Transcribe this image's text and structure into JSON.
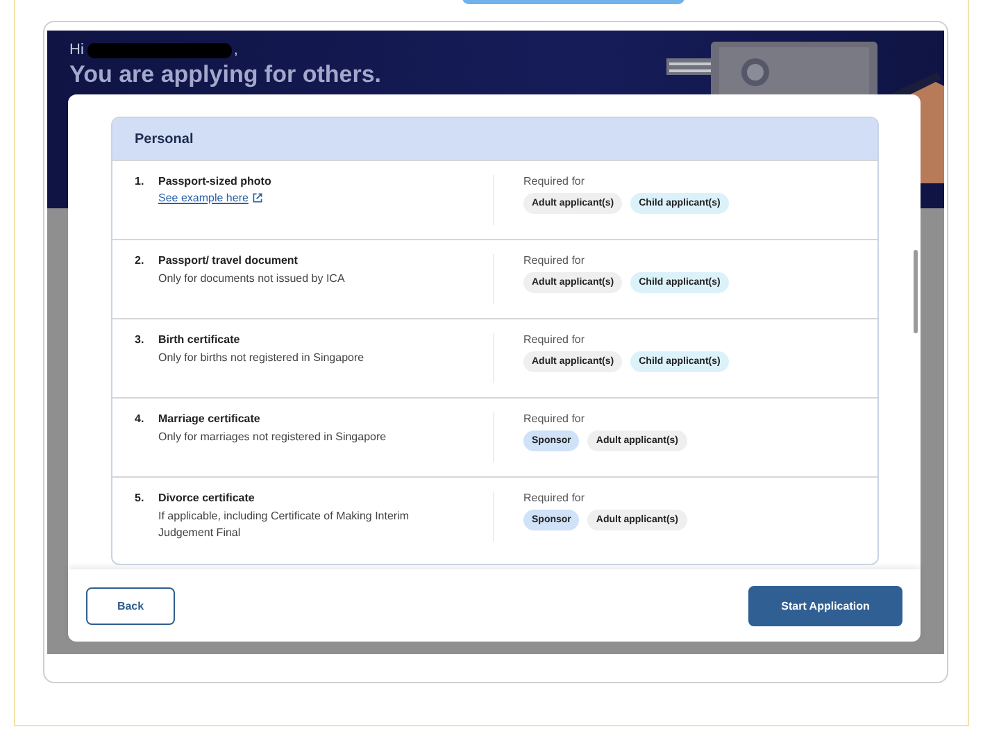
{
  "hero": {
    "greeting": "Hi",
    "greeting_end": ",",
    "title": "You are applying for others."
  },
  "section": {
    "title": "Personal"
  },
  "documents": [
    {
      "number": "1.",
      "title": "Passport-sized photo",
      "link": "See example here",
      "required_label": "Required for",
      "tags": [
        {
          "label": "Adult applicant(s)",
          "color": "#efefef"
        },
        {
          "label": "Child applicant(s)",
          "color": "#dcf2fb"
        }
      ]
    },
    {
      "number": "2.",
      "title": "Passport/ travel document",
      "note": "Only for documents not issued by ICA",
      "required_label": "Required for",
      "tags": [
        {
          "label": "Adult applicant(s)",
          "color": "#efefef"
        },
        {
          "label": "Child applicant(s)",
          "color": "#dcf2fb"
        }
      ]
    },
    {
      "number": "3.",
      "title": "Birth certificate",
      "note": "Only for births not registered in Singapore",
      "required_label": "Required for",
      "tags": [
        {
          "label": "Adult applicant(s)",
          "color": "#efefef"
        },
        {
          "label": "Child applicant(s)",
          "color": "#dcf2fb"
        }
      ]
    },
    {
      "number": "4.",
      "title": "Marriage certificate",
      "note": "Only for marriages not registered in Singapore",
      "required_label": "Required for",
      "tags": [
        {
          "label": "Sponsor",
          "color": "#cfe2f8"
        },
        {
          "label": "Adult applicant(s)",
          "color": "#efefef"
        }
      ]
    },
    {
      "number": "5.",
      "title": "Divorce certificate",
      "note": "If applicable, including Certificate of Making Interim Judgement Final",
      "required_label": "Required for",
      "tags": [
        {
          "label": "Sponsor",
          "color": "#cfe2f8"
        },
        {
          "label": "Adult applicant(s)",
          "color": "#efefef"
        }
      ]
    }
  ],
  "buttons": {
    "back": "Back",
    "start": "Start Application"
  }
}
